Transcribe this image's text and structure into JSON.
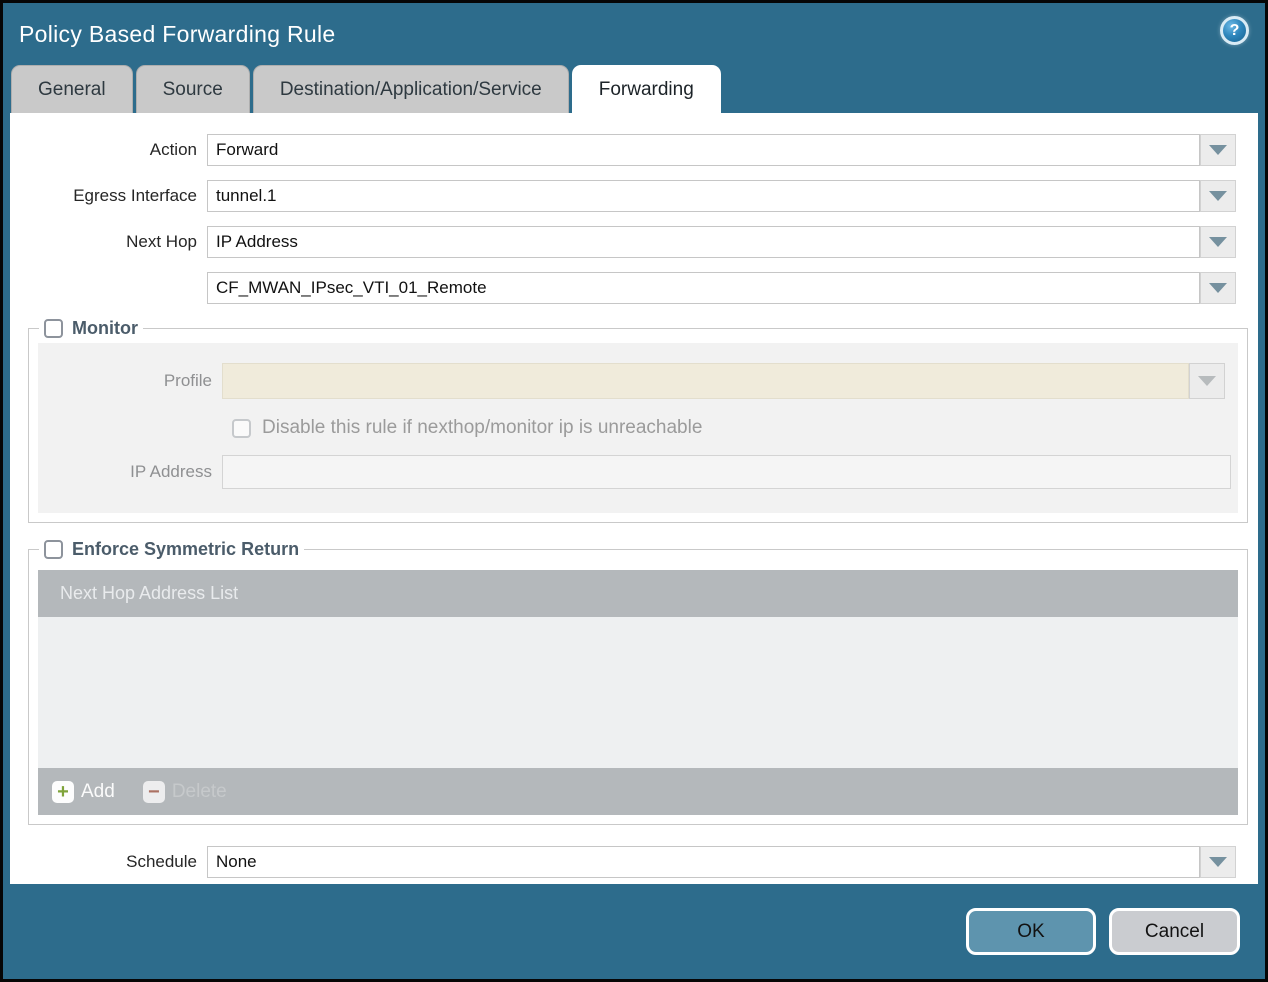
{
  "dialog": {
    "title": "Policy Based Forwarding Rule",
    "help_icon": "help-question-icon",
    "help_glyph": "?"
  },
  "tabs": [
    {
      "label": "General",
      "active": false
    },
    {
      "label": "Source",
      "active": false
    },
    {
      "label": "Destination/Application/Service",
      "active": false
    },
    {
      "label": "Forwarding",
      "active": true
    }
  ],
  "form": {
    "action": {
      "label": "Action",
      "value": "Forward"
    },
    "egress_interface": {
      "label": "Egress Interface",
      "value": "tunnel.1"
    },
    "next_hop": {
      "label": "Next Hop",
      "value": "IP Address"
    },
    "next_hop_address": {
      "value": "CF_MWAN_IPsec_VTI_01_Remote"
    },
    "schedule": {
      "label": "Schedule",
      "value": "None"
    }
  },
  "monitor": {
    "legend": "Monitor",
    "checked": false,
    "profile": {
      "label": "Profile",
      "value": ""
    },
    "disable_rule_label": "Disable this rule if nexthop/monitor ip is unreachable",
    "disable_rule_checked": false,
    "ip_address": {
      "label": "IP Address",
      "value": ""
    }
  },
  "symmetric_return": {
    "legend": "Enforce Symmetric Return",
    "checked": false,
    "table": {
      "header": "Next Hop Address List",
      "rows": []
    },
    "add_label": "Add",
    "delete_label": "Delete",
    "add_glyph": "+",
    "delete_glyph": "−"
  },
  "footer": {
    "ok_label": "OK",
    "cancel_label": "Cancel"
  },
  "colors": {
    "chrome_teal": "#2d6c8c",
    "tab_inactive": "#c9c9c9",
    "active_tab_bg": "#ffffff",
    "legend_text": "#4b5c6a",
    "disabled_field_cream": "#f0ebdb",
    "fieldset_inner_gray": "#f2f2f2",
    "table_bar_gray": "#b4b8bb",
    "table_body_gray": "#eef0f1",
    "ok_button": "#5e94ae",
    "cancel_button": "#caccd0",
    "add_icon_green": "#7fa33a",
    "delete_icon_red": "#ab7163"
  }
}
